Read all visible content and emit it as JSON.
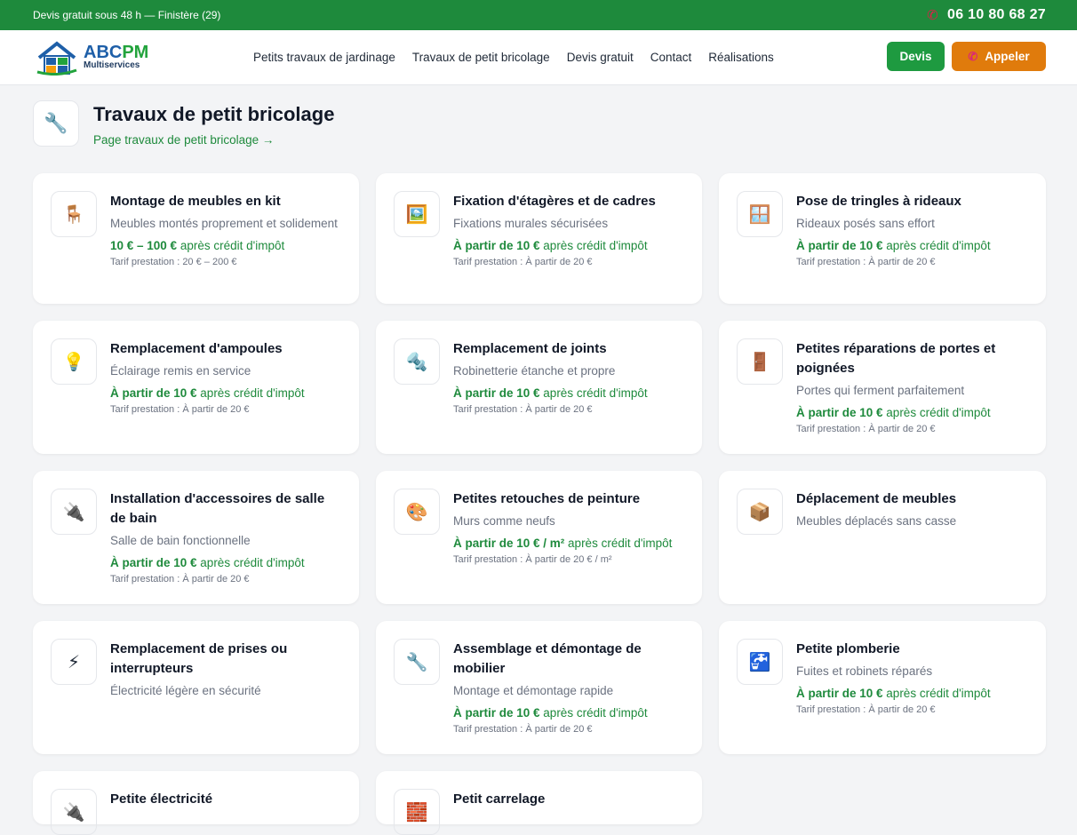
{
  "topbar": {
    "left": "Devis gratuit sous 48 h — Finistère (29)",
    "phone": "06 10 80 68 27"
  },
  "logo": {
    "abc": "ABC",
    "pm": "PM",
    "sub": "Multiservices"
  },
  "nav": [
    "Petits travaux de jardinage",
    "Travaux de petit bricolage",
    "Devis gratuit",
    "Contact",
    "Réalisations"
  ],
  "actions": {
    "devis": "Devis",
    "call": "Appeler"
  },
  "section": {
    "title": "Travaux de petit bricolage",
    "link": "Page travaux de petit bricolage →"
  },
  "cards": [
    {
      "icon": "🪑",
      "title": "Montage de meubles en kit",
      "sub": "Meubles montés proprement et solidement",
      "price": "10 € – 100 €",
      "price_suffix": "après crédit d'impôt",
      "tarif": "Tarif prestation : 20 € – 200 €"
    },
    {
      "icon": "🖼️",
      "title": "Fixation d'étagères et de cadres",
      "sub": "Fixations murales sécurisées",
      "price": "À partir de 10 €",
      "price_suffix": "après crédit d'impôt",
      "tarif": "Tarif prestation : À partir de 20 €"
    },
    {
      "icon": "🪟",
      "title": "Pose de tringles à rideaux",
      "sub": "Rideaux posés sans effort",
      "price": "À partir de 10 €",
      "price_suffix": "après crédit d'impôt",
      "tarif": "Tarif prestation : À partir de 20 €"
    },
    {
      "icon": "💡",
      "title": "Remplacement d'ampoules",
      "sub": "Éclairage remis en service",
      "price": "À partir de 10 €",
      "price_suffix": "après crédit d'impôt",
      "tarif": "Tarif prestation : À partir de 20 €"
    },
    {
      "icon": "🔩",
      "title": "Remplacement de joints",
      "sub": "Robinetterie étanche et propre",
      "price": "À partir de 10 €",
      "price_suffix": "après crédit d'impôt",
      "tarif": "Tarif prestation : À partir de 20 €"
    },
    {
      "icon": "🚪",
      "title": "Petites réparations de portes et poignées",
      "sub": "Portes qui ferment parfaitement",
      "price": "À partir de 10 €",
      "price_suffix": "après crédit d'impôt",
      "tarif": "Tarif prestation : À partir de 20 €"
    },
    {
      "icon": "🔌",
      "title": "Installation d'accessoires de salle de bain",
      "sub": "Salle de bain fonctionnelle",
      "price": "À partir de 10 €",
      "price_suffix": "après crédit d'impôt",
      "tarif": "Tarif prestation : À partir de 20 €"
    },
    {
      "icon": "🎨",
      "title": "Petites retouches de peinture",
      "sub": "Murs comme neufs",
      "price": "À partir de 10 € / m²",
      "price_suffix": "après crédit d'impôt",
      "tarif": "Tarif prestation : À partir de 20 € / m²"
    },
    {
      "icon": "📦",
      "title": "Déplacement de meubles",
      "sub": "Meubles déplacés sans casse",
      "price": "",
      "price_suffix": "",
      "tarif": ""
    },
    {
      "icon": "⚡",
      "title": "Remplacement de prises ou interrupteurs",
      "sub": "Électricité légère en sécurité",
      "price": "",
      "price_suffix": "",
      "tarif": ""
    },
    {
      "icon": "🔧",
      "title": "Assemblage et démontage de mobilier",
      "sub": "Montage et démontage rapide",
      "price": "À partir de 10 €",
      "price_suffix": "après crédit d'impôt",
      "tarif": "Tarif prestation : À partir de 20 €"
    },
    {
      "icon": "🚰",
      "title": "Petite plomberie",
      "sub": "Fuites et robinets réparés",
      "price": "À partir de 10 €",
      "price_suffix": "après crédit d'impôt",
      "tarif": "Tarif prestation : À partir de 20 €"
    },
    {
      "icon": "🔌",
      "title": "Petite électricité",
      "sub": "",
      "price": "",
      "price_suffix": "",
      "tarif": ""
    },
    {
      "icon": "🧱",
      "title": "Petit carrelage",
      "sub": "",
      "price": "",
      "price_suffix": "",
      "tarif": ""
    }
  ]
}
